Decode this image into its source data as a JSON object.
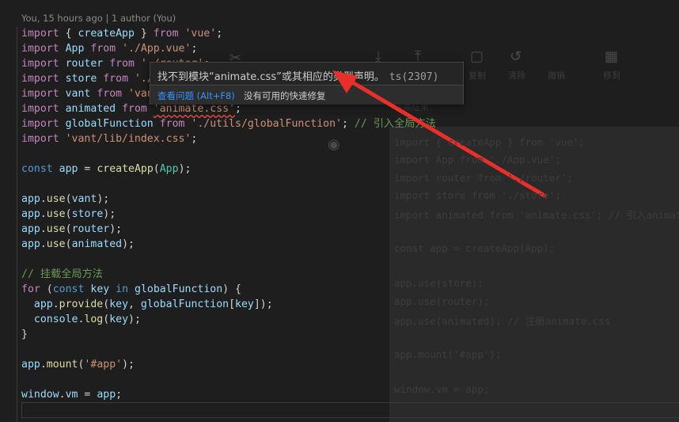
{
  "blame": "You, 15 hours ago | 1 author (You)",
  "code": {
    "l1": {
      "kw": "import",
      "a": " { ",
      "fn": "createApp",
      "b": " } ",
      "kw2": "from",
      "str": "'vue'",
      "end": ";"
    },
    "l2": {
      "kw": "import",
      "v": "App",
      "kw2": "from",
      "str": "'./App.vue'",
      "end": ";"
    },
    "l3": {
      "kw": "import",
      "v": "router",
      "kw2": "from",
      "str": "'./router'",
      "end": ";"
    },
    "l4": {
      "kw": "import",
      "v": "store",
      "kw2": "from",
      "str": "'./store'",
      "end": ";"
    },
    "l5": {
      "kw": "import",
      "v": "vant",
      "kw2": "from",
      "str": "'vant'",
      "end": ";"
    },
    "l6": {
      "kw": "import",
      "v": "animated",
      "kw2": "from",
      "str": "'animate.css'",
      "end": ";"
    },
    "l7": {
      "kw": "import",
      "v": "globalFunction",
      "kw2": "from",
      "str": "'./utils/globalFunction'",
      "end": ";",
      "cmt": " // 引入全局方法"
    },
    "l8": {
      "kw": "import",
      "str": "'vant/lib/index.css'",
      "end": ";"
    },
    "l10": {
      "kw": "const",
      "v": "app",
      "eq": " = ",
      "fn": "createApp",
      "arg": "App",
      "end": ");"
    },
    "l12": {
      "obj": "app",
      "fn": "use",
      "arg": "vant"
    },
    "l13": {
      "obj": "app",
      "fn": "use",
      "arg": "store"
    },
    "l14": {
      "obj": "app",
      "fn": "use",
      "arg": "router"
    },
    "l15": {
      "obj": "app",
      "fn": "use",
      "arg": "animated"
    },
    "l17": {
      "cmt": "// 挂载全局方法"
    },
    "l18": {
      "kw": "for",
      "a": " (",
      "kw2": "const",
      "v": "key",
      "kw3": "in",
      "v2": "globalFunction",
      "b": ") {"
    },
    "l19": {
      "obj": "app",
      "fn": "provide",
      "v": "key",
      "v2": "globalFunction",
      "v3": "key"
    },
    "l20": {
      "obj": "console",
      "fn": "log",
      "v": "key"
    },
    "l21": {
      "t": "}"
    },
    "l23": {
      "obj": "app",
      "fn": "mount",
      "str": "'#app'"
    },
    "l25": {
      "obj": "window",
      "v": "vm",
      "eq": " = ",
      "v2": "app",
      "end": ";"
    }
  },
  "hover": {
    "message": "找不到模块“animate.css”或其相应的类型声明。",
    "code": "ts(2307)",
    "view_problem": "查看问题 (Alt+F8)",
    "no_fix": "没有可用的快速修复"
  },
  "background": {
    "toolbar_labels": [
      "复制",
      "清除",
      "撤销",
      "移到"
    ],
    "panel_title": "转换结果:",
    "ghost_lines": [
      "import { createApp } from 'vue';",
      "import App from './App.vue';",
      "import router from './router';",
      "import store from './store';",
      "import animated from 'animate.css'; // 引入animate",
      "",
      "const app = createApp(App);",
      "",
      "app.use(store);",
      "app.use(router);",
      "app.use(animated); // 注册animate.css",
      "",
      "app.mount('#app');",
      "",
      "window.vm = app;"
    ]
  },
  "colors": {
    "arrow": "#e8302a",
    "squiggle": "#f14c4c",
    "link": "#3794ff"
  }
}
